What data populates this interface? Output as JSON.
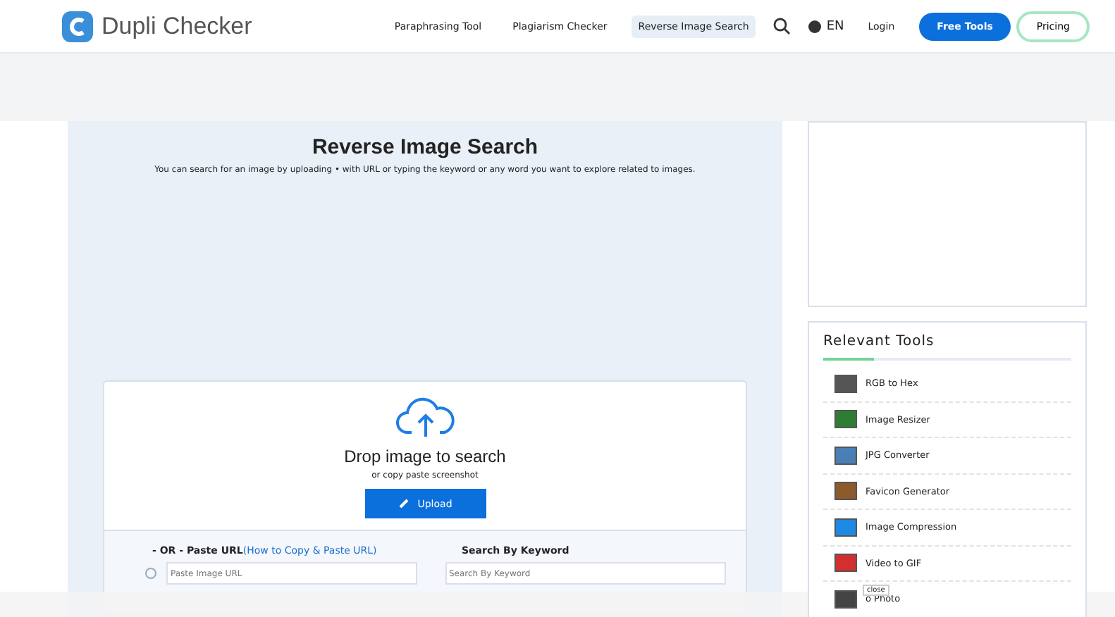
{
  "header": {
    "logo": "Dupli Checker",
    "nav": [
      {
        "label": "Paraphrasing Tool",
        "selected": false
      },
      {
        "label": "Plagiarism Checker",
        "selected": false
      },
      {
        "label": "Reverse Image Search",
        "selected": true
      }
    ],
    "language": "EN",
    "login": "Login",
    "free_tools": "Free Tools",
    "pricing": "Pricing"
  },
  "main": {
    "title": "Reverse Image Search",
    "description": "You can search for an image by uploading • with URL or typing the keyword or any word you want to explore related to images.",
    "drop_title": "Drop image to search",
    "drop_subtitle": "or copy paste screenshot",
    "upload": "Upload",
    "url_label": "- OR - Paste URL",
    "url_link": "(How to Copy & Paste URL)",
    "url_placeholder": "Paste Image URL",
    "keyword_label": "Search By Keyword",
    "keyword_placeholder": "Search By Keyword"
  },
  "sidebar": {
    "title": "Relevant Tools",
    "tools": [
      {
        "label": "RGB to Hex",
        "color": "#555555"
      },
      {
        "label": "Image Resizer",
        "color": "#2e7d32"
      },
      {
        "label": "JPG Converter",
        "color": "#4a7fb5"
      },
      {
        "label": "Favicon Generator",
        "color": "#8d5a2b"
      },
      {
        "label": "Image Compression",
        "color": "#1e88e5"
      },
      {
        "label": "Video to GIF",
        "color": "#d32f2f"
      },
      {
        "label": "o Photo",
        "color": "#444444"
      }
    ],
    "tooltip": "close"
  }
}
